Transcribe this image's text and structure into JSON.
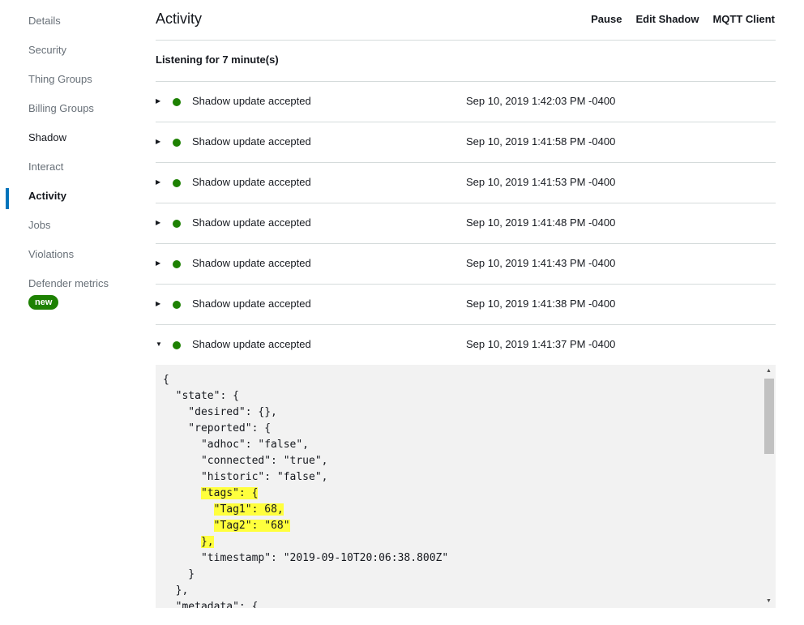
{
  "sidebar": {
    "items": [
      {
        "label": "Details"
      },
      {
        "label": "Security"
      },
      {
        "label": "Thing Groups"
      },
      {
        "label": "Billing Groups"
      },
      {
        "label": "Shadow"
      },
      {
        "label": "Interact"
      },
      {
        "label": "Activity"
      },
      {
        "label": "Jobs"
      },
      {
        "label": "Violations"
      },
      {
        "label": "Defender metrics"
      }
    ],
    "new_badge": "new"
  },
  "header": {
    "title": "Activity",
    "actions": {
      "pause": "Pause",
      "edit_shadow": "Edit Shadow",
      "mqtt_client": "MQTT Client"
    }
  },
  "listening": "Listening for 7 minute(s)",
  "rows": [
    {
      "label": "Shadow update accepted",
      "time": "Sep 10, 2019 1:42:03 PM -0400"
    },
    {
      "label": "Shadow update accepted",
      "time": "Sep 10, 2019 1:41:58 PM -0400"
    },
    {
      "label": "Shadow update accepted",
      "time": "Sep 10, 2019 1:41:53 PM -0400"
    },
    {
      "label": "Shadow update accepted",
      "time": "Sep 10, 2019 1:41:48 PM -0400"
    },
    {
      "label": "Shadow update accepted",
      "time": "Sep 10, 2019 1:41:43 PM -0400"
    },
    {
      "label": "Shadow update accepted",
      "time": "Sep 10, 2019 1:41:38 PM -0400"
    },
    {
      "label": "Shadow update accepted",
      "time": "Sep 10, 2019 1:41:37 PM -0400"
    }
  ],
  "code": {
    "lines": [
      "{",
      "  \"state\": {",
      "    \"desired\": {},",
      "    \"reported\": {",
      "      \"adhoc\": \"false\",",
      "      \"connected\": \"true\",",
      "      \"historic\": \"false\",",
      "      \"tags\": {",
      "        \"Tag1\": 68,",
      "        \"Tag2\": \"68\"",
      "      },",
      "      \"timestamp\": \"2019-09-10T20:06:38.800Z\"",
      "    }",
      "  },",
      "  \"metadata\": {"
    ]
  },
  "colors": {
    "status_green": "#1d8102",
    "highlight_yellow": "#ffff3d",
    "active_blue": "#0073bb"
  }
}
